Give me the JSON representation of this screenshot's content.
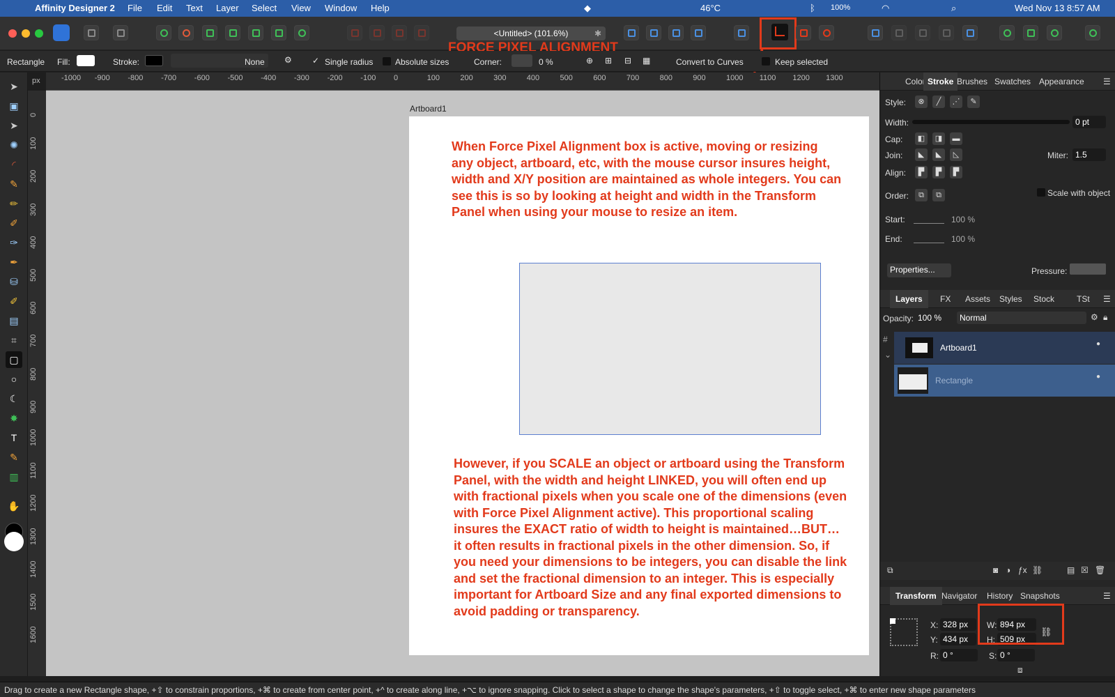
{
  "menubar": {
    "app": "Affinity Designer 2",
    "items": [
      "File",
      "Edit",
      "Text",
      "Layer",
      "Select",
      "View",
      "Window",
      "Help"
    ],
    "temp": "46°C",
    "battery": "100%",
    "datetime": "Wed Nov 13  8:57 AM"
  },
  "doc_title": "<Untitled> (101.6%)",
  "annotation_label": "FORCE PIXEL ALIGNMENT",
  "context": {
    "tool": "Rectangle",
    "fill_label": "Fill:",
    "stroke_label": "Stroke:",
    "stroke_style": "None",
    "single_radius": "Single radius",
    "absolute_sizes": "Absolute sizes",
    "corner_label": "Corner:",
    "corner_value": "0 %",
    "convert_label": "Convert to Curves",
    "keep_selected": "Keep selected"
  },
  "ruler": {
    "unit": "px",
    "top_ticks": [
      "-1000",
      "-900",
      "-800",
      "-700",
      "-600",
      "-500",
      "-400",
      "-300",
      "-200",
      "-100",
      "0",
      "100",
      "200",
      "300",
      "400",
      "500",
      "600",
      "700",
      "800",
      "900",
      "1000",
      "1100",
      "1200",
      "1300"
    ],
    "left_ticks": [
      "0",
      "100",
      "200",
      "300",
      "400",
      "500",
      "600",
      "700",
      "800",
      "900",
      "1000",
      "1100",
      "1200",
      "1300",
      "1400",
      "1500",
      "1600"
    ]
  },
  "canvas": {
    "artboard_label": "Artboard1",
    "note_top": "When Force Pixel Alignment box is active, moving or resizing any object, artboard, etc, with the mouse cursor insures height, width and X/Y position are maintained as whole integers. You can see this is so by looking at height and width in the Transform Panel when using your mouse to resize an item.",
    "note_bottom": "However, if you SCALE an object or artboard using the Transform Panel, with the width and height LINKED, you will often end up with fractional pixels when you scale one of the dimensions (even with Force Pixel Alignment active). This proportional scaling insures the EXACT ratio of width to height is maintained…BUT…it often results in fractional pixels in the other dimension. So, if you need your dimensions to be integers, you can disable the link and set the fractional dimension to an integer. This is especially important for Artboard Size and any final exported dimensions to avoid padding or transparency."
  },
  "stroke_panel": {
    "tabs": [
      "Color",
      "Stroke",
      "Brushes",
      "Swatches",
      "Appearance"
    ],
    "active_tab": "Stroke",
    "style_label": "Style:",
    "width_label": "Width:",
    "width_value": "0 pt",
    "cap_label": "Cap:",
    "join_label": "Join:",
    "miter_label": "Miter:",
    "miter_value": "1.5",
    "align_label": "Align:",
    "order_label": "Order:",
    "scale_with_object": "Scale with object",
    "start_label": "Start:",
    "start_value": "100 %",
    "end_label": "End:",
    "end_value": "100 %",
    "properties_button": "Properties...",
    "pressure_label": "Pressure:"
  },
  "layers_panel": {
    "tabs": [
      "Layers",
      "FX",
      "Assets",
      "Styles",
      "Stock",
      "TSt"
    ],
    "active_tab": "Layers",
    "opacity_label": "Opacity:",
    "opacity_value": "100 %",
    "blend_mode": "Normal",
    "layers": [
      {
        "name": "Artboard1"
      },
      {
        "name": "Rectangle"
      }
    ]
  },
  "transform_panel": {
    "tabs": [
      "Transform",
      "Navigator",
      "History",
      "Snapshots"
    ],
    "active_tab": "Transform",
    "x_label": "X:",
    "x_value": "328 px",
    "y_label": "Y:",
    "y_value": "434 px",
    "w_label": "W:",
    "w_value": "894 px",
    "h_label": "H:",
    "h_value": "509 px",
    "r_label": "R:",
    "r_value": "0 °",
    "s_label": "S:",
    "s_value": "0 °"
  },
  "status": "Drag to create a new Rectangle shape, +⇧ to constrain proportions, +⌘ to create from center point, +^ to create along line, +⌥ to ignore snapping. Click to select a shape to change the shape's parameters, +⇧ to toggle select, +⌘ to enter new shape parameters",
  "colors": {
    "accent": "#e23a1b",
    "menubar": "#2c5ea8",
    "selection": "#5b7fcf"
  }
}
